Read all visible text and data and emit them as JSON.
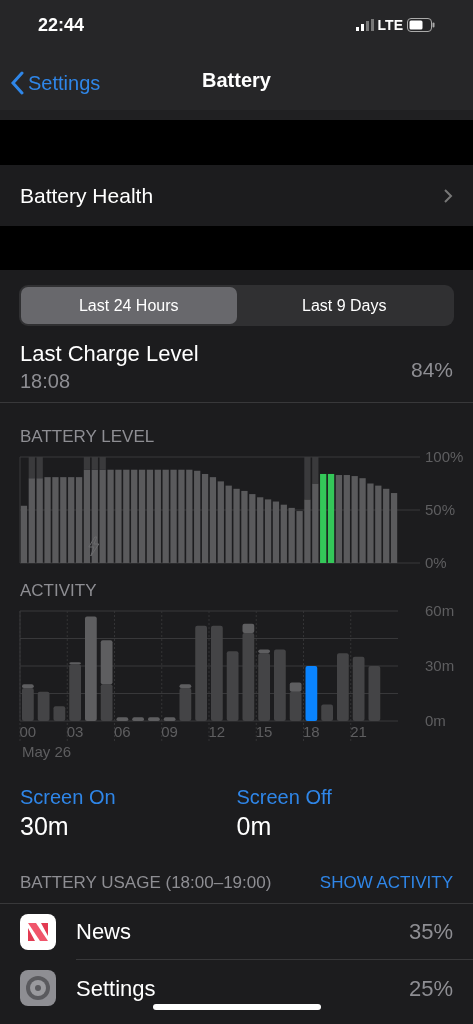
{
  "status_bar": {
    "time": "22:44",
    "network": "LTE"
  },
  "nav": {
    "back": "Settings",
    "title": "Battery"
  },
  "battery_health": {
    "label": "Battery Health"
  },
  "tabs": [
    {
      "label": "Last 24 Hours",
      "selected": true
    },
    {
      "label": "Last 9 Days",
      "selected": false
    }
  ],
  "last_charge": {
    "label": "Last Charge Level",
    "time": "18:08",
    "value": "84%"
  },
  "battery_level": {
    "title": "BATTERY LEVEL",
    "chart_data": {
      "type": "bar",
      "stacked": true,
      "series": [
        {
          "color": "#5a5a5c",
          "values": [
            54,
            80,
            80,
            81,
            81,
            81,
            81,
            81,
            88,
            88,
            88,
            88,
            88,
            88,
            88,
            88,
            88,
            88,
            88,
            88,
            88,
            88,
            87,
            84,
            81,
            77,
            73,
            70,
            68,
            65,
            62,
            60,
            58,
            55,
            52,
            49,
            60,
            75,
            null,
            null,
            83,
            83,
            82,
            80,
            75,
            73,
            70,
            66
          ]
        },
        {
          "color": "#34c759",
          "values": [
            null,
            null,
            null,
            null,
            null,
            null,
            null,
            null,
            null,
            null,
            null,
            null,
            null,
            null,
            null,
            null,
            null,
            null,
            null,
            null,
            null,
            null,
            null,
            null,
            null,
            null,
            null,
            null,
            null,
            null,
            null,
            null,
            null,
            null,
            null,
            null,
            null,
            null,
            84,
            84,
            null,
            null,
            null,
            null,
            null,
            null,
            null,
            null
          ]
        },
        {
          "color": "#3a3a3c",
          "values": [
            null,
            20,
            20,
            null,
            null,
            null,
            null,
            null,
            12,
            12,
            12,
            null,
            null,
            null,
            null,
            null,
            null,
            null,
            null,
            null,
            null,
            null,
            null,
            null,
            null,
            null,
            null,
            null,
            null,
            null,
            null,
            null,
            null,
            null,
            null,
            null,
            40,
            25,
            null,
            null,
            null,
            null,
            null,
            null,
            null,
            null,
            null,
            null
          ]
        }
      ],
      "ylim": [
        0,
        100
      ],
      "yticks": [
        {
          "value": 0,
          "label": "0%"
        },
        {
          "value": 50,
          "label": "50%"
        },
        {
          "value": 100,
          "label": "100%"
        }
      ]
    }
  },
  "activity": {
    "title": "ACTIVITY",
    "date": "May 26",
    "chart_data": {
      "type": "bar",
      "stacked": true,
      "xlim": [
        -0.5,
        23.5
      ],
      "x": [
        0,
        1,
        2,
        3,
        4,
        5,
        6,
        7,
        8,
        9,
        10,
        11,
        12,
        13,
        14,
        15,
        16,
        17,
        18,
        19,
        20,
        21,
        22
      ],
      "series": [
        {
          "color": "#444446",
          "values": [
            18,
            16,
            8,
            31,
            null,
            20,
            null,
            null,
            null,
            null,
            18,
            52,
            52,
            38,
            48,
            37,
            39,
            16,
            null,
            9,
            37,
            35,
            30
          ]
        },
        {
          "color": "#5e5e60",
          "values": [
            2,
            null,
            null,
            1,
            57,
            24,
            2,
            2,
            2,
            2,
            2,
            null,
            null,
            null,
            5,
            2,
            null,
            5,
            null,
            null,
            null,
            null,
            null
          ]
        },
        {
          "color": "#0a84ff",
          "values": [
            null,
            null,
            null,
            null,
            null,
            null,
            null,
            null,
            null,
            null,
            null,
            null,
            null,
            null,
            null,
            null,
            null,
            null,
            30,
            null,
            null,
            null,
            null
          ]
        }
      ],
      "ylim": [
        0,
        60
      ],
      "xticks": [
        {
          "value": 0,
          "label": "00"
        },
        {
          "value": 3,
          "label": "03"
        },
        {
          "value": 6,
          "label": "06"
        },
        {
          "value": 9,
          "label": "09"
        },
        {
          "value": 12,
          "label": "12"
        },
        {
          "value": 15,
          "label": "15"
        },
        {
          "value": 18,
          "label": "18"
        },
        {
          "value": 21,
          "label": "21"
        }
      ],
      "yticks": [
        {
          "value": 0,
          "label": "0m"
        },
        {
          "value": 30,
          "label": "30m"
        },
        {
          "value": 60,
          "label": "60m"
        }
      ]
    }
  },
  "screen_stats": [
    {
      "label": "Screen On",
      "value": "30m"
    },
    {
      "label": "Screen Off",
      "value": "0m"
    }
  ],
  "usage": {
    "title": "BATTERY USAGE (18:00–19:00)",
    "action": "SHOW ACTIVITY",
    "apps": [
      {
        "kind": "news",
        "name": "News",
        "value": "35%"
      },
      {
        "kind": "settings",
        "name": "Settings",
        "value": "25%"
      }
    ]
  }
}
